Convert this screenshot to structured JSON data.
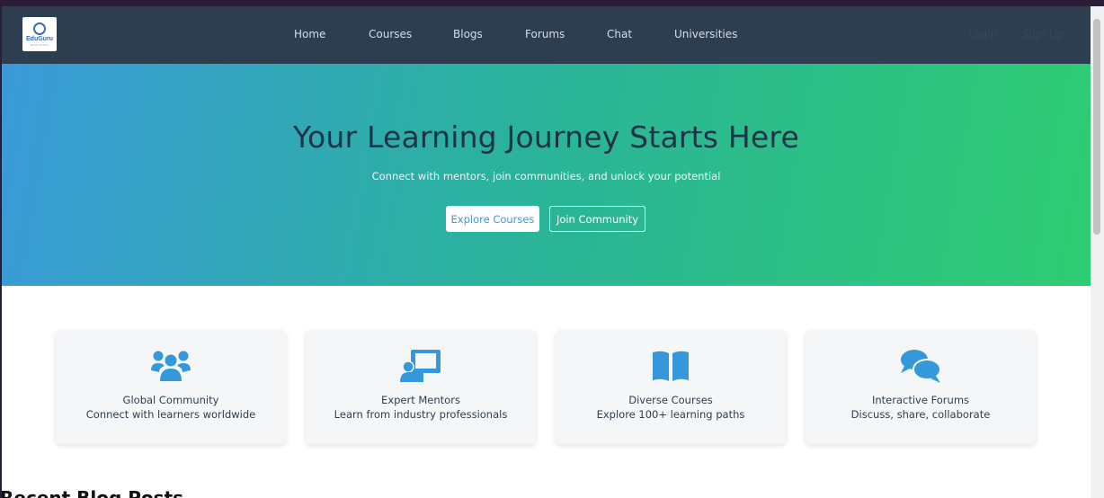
{
  "brand": {
    "logo_text": "EduGuru",
    "logo_sub": "EDUCATION"
  },
  "nav": {
    "links": [
      "Home",
      "Courses",
      "Blogs",
      "Forums",
      "Chat",
      "Universities"
    ],
    "login": "Login",
    "signup": "Sign Up"
  },
  "hero": {
    "title": "Your Learning Journey Starts Here",
    "subtitle": "Connect with mentors, join communities, and unlock your potential",
    "primary_button": "Explore Courses",
    "secondary_button": "Join Community"
  },
  "features": [
    {
      "icon": "users-icon",
      "title": "Global Community",
      "desc": "Connect with learners worldwide"
    },
    {
      "icon": "teacher-board-icon",
      "title": "Expert Mentors",
      "desc": "Learn from industry professionals"
    },
    {
      "icon": "book-open-icon",
      "title": "Diverse Courses",
      "desc": "Explore 100+ learning paths"
    },
    {
      "icon": "comments-icon",
      "title": "Interactive Forums",
      "desc": "Discuss, share, collaborate"
    }
  ],
  "section": {
    "recent_blog_heading": "Recent Blog Posts"
  },
  "colors": {
    "navbar": "#2c3e50",
    "hero_start": "#3a9ad9",
    "hero_end": "#2ecc71",
    "icon_blue": "#3498db",
    "text_dark": "#2c3e50"
  }
}
